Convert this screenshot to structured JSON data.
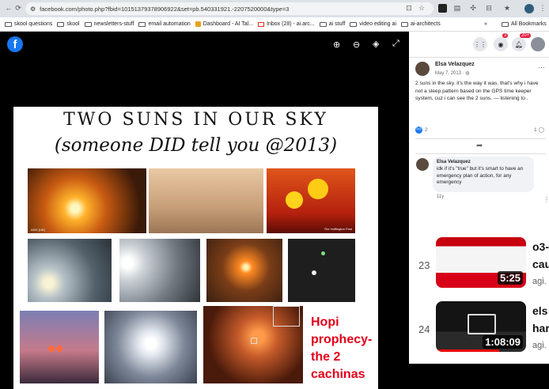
{
  "browser": {
    "url": "facebook.com/photo.php?fbid=10151379378906922&set=pb.540331921.-2207520000&type=3"
  },
  "bookmarks": [
    "skool questions",
    "skool",
    "newsletters-stuff",
    "email automation",
    "Dashboard - AI Tal...",
    "Inbox (28) - ai.arc...",
    "ai stuff",
    "video editing ai",
    "ai-architects"
  ],
  "bookmarks_more": "»",
  "bookmarks_all": "All Bookmarks",
  "photo": {
    "title": "TWO SUNS IN OUR SKY",
    "subtitle": "(someone DID tell you @2013)",
    "hopi_text": "Hopi prophecy- the 2 cachinas",
    "img_caption_1": "ADG (UK)",
    "img_caption_2": "The Huffington Post"
  },
  "header": {
    "messenger_badge": "3",
    "notif_badge": "20+"
  },
  "post": {
    "author": "Elsa Velazquez",
    "date": "May 7, 2013 · ",
    "text": "2 suns in the sky. it's the way it was. that's why i have not a sleep pattern based on the GPS time keeper system, cuz i can see the 2 suns. — listening to .",
    "reactions": "2",
    "comments": "1"
  },
  "comment": {
    "author": "Elsa Velazquez",
    "text": "idk if it's \"true\" but it's smart to have an emergency plan of action, for any emergency",
    "age": "11y"
  },
  "videos": [
    {
      "num": "23",
      "duration": "5:25",
      "title": "o3-",
      "title2": "cau",
      "channel": "agi."
    },
    {
      "num": "24",
      "duration": "1:08:09",
      "title": "els",
      "title2": "har",
      "channel": "agi."
    }
  ]
}
